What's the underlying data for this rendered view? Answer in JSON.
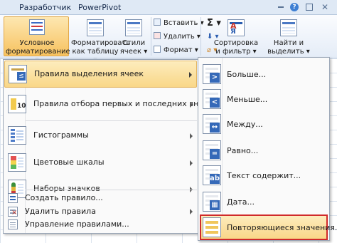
{
  "ribbon": {
    "tabs": [
      "Разработчик",
      "PowerPivot"
    ],
    "cond_format": {
      "line1": "Условное",
      "line2": "форматирование ▾"
    },
    "format_table": {
      "line1": "Форматировать",
      "line2": "как таблицу ▾"
    },
    "cell_styles": {
      "line1": "Стили",
      "line2": "ячеек ▾"
    },
    "insert": "Вставить ▾",
    "delete": "Удалить ▾",
    "format": "Формат ▾",
    "sum_glyph": "Σ ▾",
    "fill_glyph": "⬇ ▾",
    "clear_glyph": "⌀ ▾",
    "sort": {
      "line1": "Сортировка",
      "line2": "и фильтр ▾"
    },
    "find": {
      "line1": "Найти и",
      "line2": "выделить ▾"
    },
    "window_controls": {
      "help": "?",
      "close": "✕"
    }
  },
  "menu": {
    "items": [
      {
        "label": "Правила выделения ячеек",
        "icon": "highlight-rules-icon",
        "selected": true,
        "has_submenu": true
      },
      {
        "label": "Правила отбора первых и последних значений",
        "icon": "top-bottom-rules-icon",
        "has_submenu": true
      },
      {
        "label": "Гистограммы",
        "icon": "data-bars-icon",
        "has_submenu": true
      },
      {
        "label": "Цветовые шкалы",
        "icon": "color-scales-icon",
        "has_submenu": true
      },
      {
        "label": "Наборы значков",
        "icon": "icon-sets-icon",
        "has_submenu": true
      }
    ],
    "actions": [
      {
        "label": "Создать правило...",
        "icon": "new-rule-icon"
      },
      {
        "label": "Удалить правила",
        "icon": "clear-rules-icon",
        "has_submenu": true
      },
      {
        "label": "Управление правилами...",
        "icon": "manage-rules-icon"
      }
    ]
  },
  "submenu": {
    "items": [
      {
        "label": "Больше...",
        "icon": "greater-than-icon"
      },
      {
        "label": "Меньше...",
        "icon": "less-than-icon"
      },
      {
        "label": "Между...",
        "icon": "between-icon"
      },
      {
        "label": "Равно...",
        "icon": "equal-to-icon"
      },
      {
        "label": "Текст содержит...",
        "icon": "text-contains-icon"
      },
      {
        "label": "Дата...",
        "icon": "date-occurring-icon"
      },
      {
        "label": "Повторяющиеся значения...",
        "icon": "duplicate-values-icon",
        "highlighted": true
      }
    ]
  },
  "colors": {
    "highlight_border": "#d02a2a",
    "selection_fill": "#fbe0a2",
    "ribbon_bg": "#dfe9f5"
  }
}
